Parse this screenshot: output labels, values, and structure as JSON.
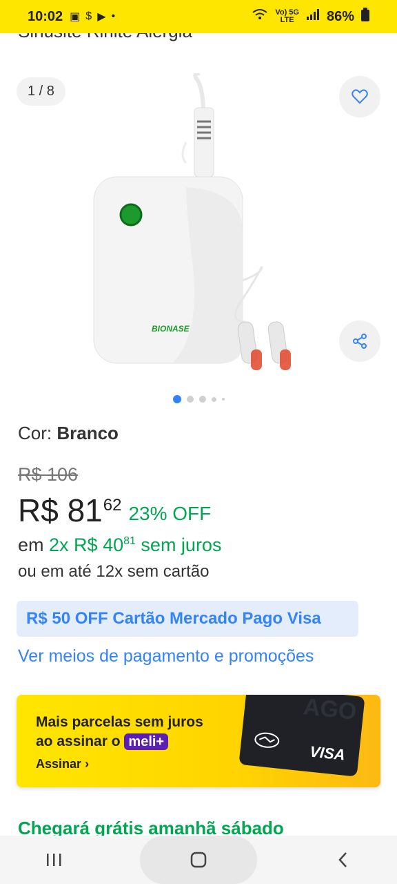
{
  "status_bar": {
    "time": "10:02",
    "battery": "86%",
    "network_top": "Vo) 5G",
    "network_bottom": "LTE"
  },
  "product": {
    "title_partial": "Sinusite Rinite Alergia",
    "gallery_counter": "1 / 8",
    "brand_on_device": "BIONASE",
    "current_image_index": 1,
    "total_images": 8,
    "color_label": "Cor:",
    "color_value": "Branco"
  },
  "pricing": {
    "original_price": "R$ 106",
    "price_currency_whole": "R$ 81",
    "price_cents": "62",
    "discount": "23% OFF",
    "installments_prefix": "em",
    "installments_value": "2x R$ 40",
    "installments_cents": "81",
    "installments_suffix": "sem juros",
    "alt_installments": "ou em até 12x sem cartão"
  },
  "promo": {
    "banner": "R$ 50 OFF Cartão Mercado Pago Visa",
    "payment_link": "Ver meios de pagamento e promoções"
  },
  "meli_plus": {
    "line1": "Mais parcelas sem juros",
    "line2": "ao assinar o",
    "badge": "meli+",
    "cta": "Assinar",
    "card_brand": "VISA",
    "card_ghost": "AGO"
  },
  "delivery": {
    "text": "Chegará grátis amanhã sábado"
  },
  "colors": {
    "brand_yellow": "#FFE600",
    "accent_blue": "#3483FA",
    "green": "#00A650",
    "meli_purple": "#5B1FB3"
  },
  "icons": [
    "heart-icon",
    "share-icon",
    "back-icon",
    "home-icon",
    "recent-apps-icon"
  ]
}
